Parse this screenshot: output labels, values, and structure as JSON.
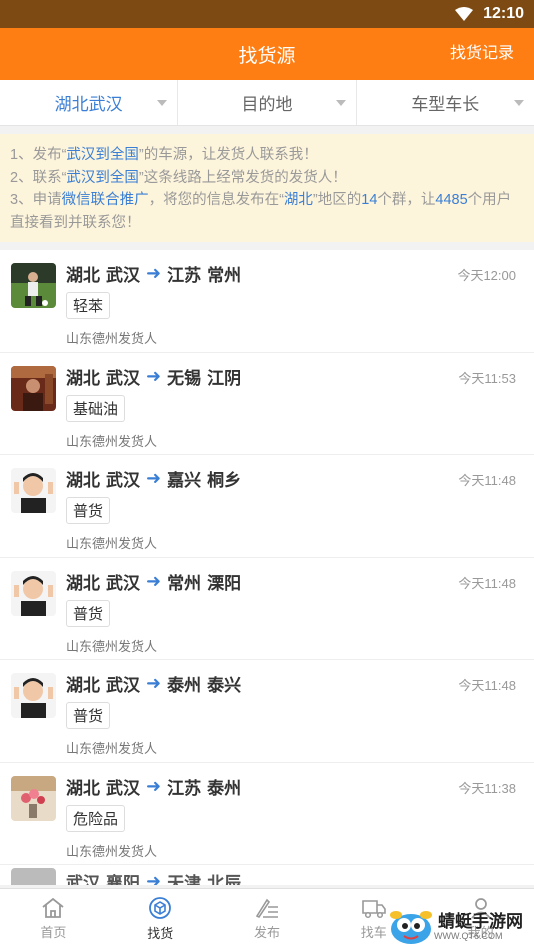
{
  "status_bar": {
    "time": "12:10"
  },
  "app_bar": {
    "title": "找货源",
    "action": "找货记录"
  },
  "filters": [
    {
      "label": "湖北武汉",
      "active": true
    },
    {
      "label": "目的地",
      "active": false
    },
    {
      "label": "车型车长",
      "active": false
    }
  ],
  "notice": {
    "line1": {
      "a": "1、发布“",
      "hl": "武汉到全国",
      "b": "”的车源，让发货人联系我！"
    },
    "line2": {
      "a": "2、联系“",
      "hl": "武汉到全国",
      "b": "”这条线路上经常发货的发货人！"
    },
    "line3": {
      "a": "3、申请",
      "hl1": "微信联合推广",
      "b": "，将您的信息发布在“",
      "hl2": "湖北",
      "c": "”地区的",
      "hl3": "14",
      "d": "个群，让",
      "hl4": "4485",
      "e": "个用户直接看到并联系您！"
    }
  },
  "listings": [
    {
      "from_prov": "湖北",
      "from_city": "武汉",
      "to_prov": "江苏",
      "to_city": "常州",
      "time": "今天12:00",
      "cargo": "轻苯",
      "shipper": "山东德州发货人",
      "avatar": "soccer-player"
    },
    {
      "from_prov": "湖北",
      "from_city": "武汉",
      "to_prov": "无锡",
      "to_city": "江阴",
      "time": "今天11:53",
      "cargo": "基础油",
      "shipper": "山东德州发货人",
      "avatar": "person-photo"
    },
    {
      "from_prov": "湖北",
      "from_city": "武汉",
      "to_prov": "嘉兴",
      "to_city": "桐乡",
      "time": "今天11:48",
      "cargo": "普货",
      "shipper": "山东德州发货人",
      "avatar": "child-photo"
    },
    {
      "from_prov": "湖北",
      "from_city": "武汉",
      "to_prov": "常州",
      "to_city": "溧阳",
      "time": "今天11:48",
      "cargo": "普货",
      "shipper": "山东德州发货人",
      "avatar": "child-photo"
    },
    {
      "from_prov": "湖北",
      "from_city": "武汉",
      "to_prov": "泰州",
      "to_city": "泰兴",
      "time": "今天11:48",
      "cargo": "普货",
      "shipper": "山东德州发货人",
      "avatar": "child-photo"
    },
    {
      "from_prov": "湖北",
      "from_city": "武汉",
      "to_prov": "江苏",
      "to_city": "泰州",
      "time": "今天11:38",
      "cargo": "危险品",
      "shipper": "山东德州发货人",
      "avatar": "flowers-photo"
    }
  ],
  "partial_item": {
    "from_prov": "武汉",
    "from_city": "襄阳",
    "to_prov": "天津",
    "to_city": "北辰"
  },
  "bottom_nav": [
    {
      "label": "首页",
      "icon": "home-icon",
      "active": false
    },
    {
      "label": "找货",
      "icon": "cube-icon",
      "active": true
    },
    {
      "label": "发布",
      "icon": "edit-icon",
      "active": false
    },
    {
      "label": "找车",
      "icon": "truck-icon",
      "active": false
    },
    {
      "label": "我的",
      "icon": "user-icon",
      "active": false
    }
  ],
  "watermark": {
    "name": "蜻蜓手游网",
    "url": "WWW.QT6.COM"
  },
  "colors": {
    "status_bar": "#7d4a14",
    "app_bar": "#ff7e13",
    "accent_blue": "#3a7fd5",
    "notice_bg": "#fdf4dc"
  }
}
